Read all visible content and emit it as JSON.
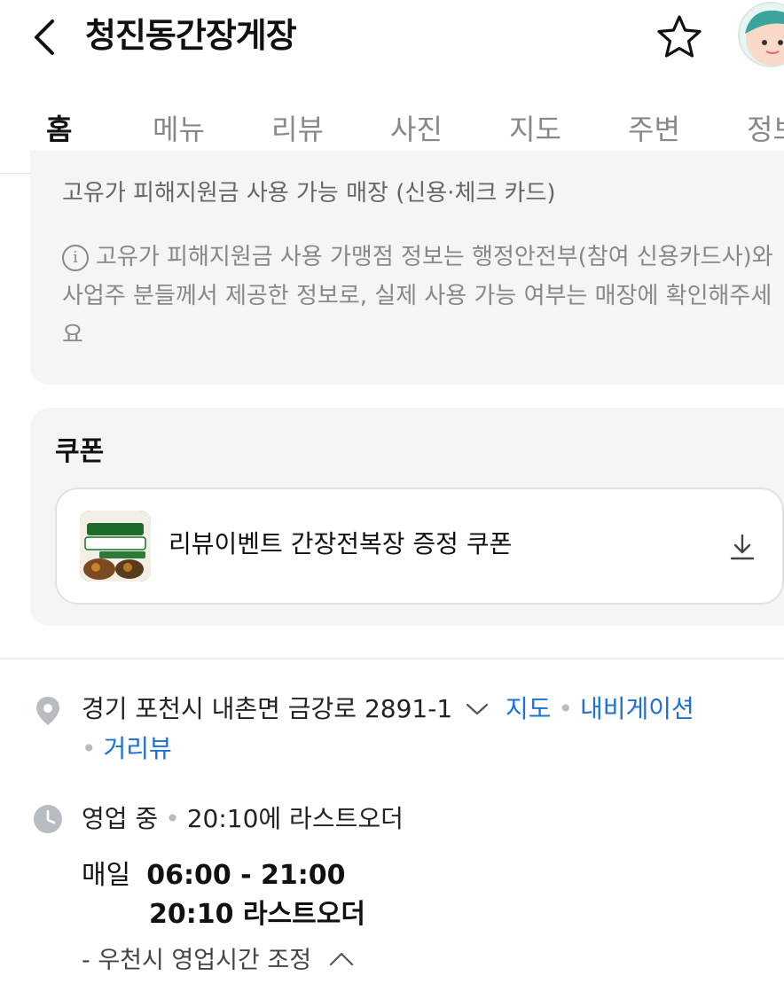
{
  "header": {
    "title": "청진동간장게장"
  },
  "tabs": [
    {
      "label": "홈"
    },
    {
      "label": "메뉴"
    },
    {
      "label": "리뷰"
    },
    {
      "label": "사진"
    },
    {
      "label": "지도"
    },
    {
      "label": "주변"
    },
    {
      "label": "정보"
    }
  ],
  "info": {
    "title": "고유가 피해지원금 사용 가능 매장 (신용·체크 카드)",
    "notice": "고유가 피해지원금 사용 가맹점 정보는 행정안전부(참여 신용카드사)와 사업주 분들께서 제공한 정보로, 실제 사용 가능 여부는 매장에 확인해주세요"
  },
  "coupon": {
    "heading": "쿠폰",
    "label": "리뷰이벤트 간장전복장 증정 쿠폰"
  },
  "address": {
    "text": "경기 포천시 내촌면 금강로 2891-1",
    "links": [
      "지도",
      "내비게이션",
      "거리뷰"
    ]
  },
  "hours": {
    "status": "영업 중",
    "lastorder": "20:10에 라스트오더",
    "day": "매일",
    "time": "06:00 - 21:00",
    "lastorder_time": "20:10 라스트오더",
    "rain_note": "- 우천시 영업시간 조정"
  },
  "colors": {
    "link": "#1e6fd9",
    "card_bg": "#f5f5f5"
  }
}
